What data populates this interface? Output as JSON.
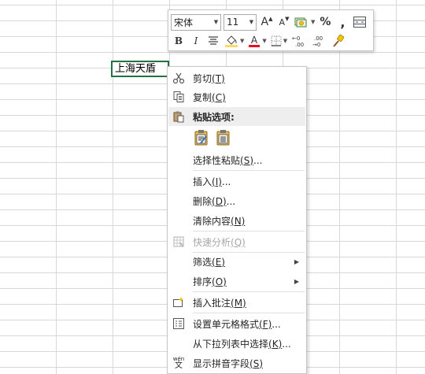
{
  "cell": {
    "value": "上海天盾"
  },
  "mini_toolbar": {
    "font_name": "宋体",
    "font_size": "11",
    "increase_font": "A",
    "decrease_font": "A",
    "percent": "%",
    "comma": ",",
    "bold": "B",
    "italic": "I",
    "font_color_letter": "A",
    "increase_decimal": ".00",
    "decrease_decimal": ".00",
    "font_color": "#e81123",
    "fill_color": "#ffd966"
  },
  "menu": {
    "cut": {
      "label": "剪切",
      "key": "(T)"
    },
    "copy": {
      "label": "复制",
      "key": "(C)"
    },
    "paste_options": {
      "label": "粘贴选项:"
    },
    "paste_special": {
      "label": "选择性粘贴",
      "key": "(S)",
      "suffix": "..."
    },
    "insert": {
      "label": "插入",
      "key": "(I)",
      "suffix": "..."
    },
    "delete": {
      "label": "删除",
      "key": "(D)",
      "suffix": "..."
    },
    "clear": {
      "label": "清除内容",
      "key": "(N)"
    },
    "quick_analysis": {
      "label": "快速分析",
      "key": "(Q)"
    },
    "filter": {
      "label": "筛选",
      "key": "(E)"
    },
    "sort": {
      "label": "排序",
      "key": "(O)"
    },
    "insert_comment": {
      "label": "插入批注",
      "key": "(M)"
    },
    "format_cells": {
      "label": "设置单元格格式",
      "key": "(F)",
      "suffix": "..."
    },
    "pick_list": {
      "label": "从下拉列表中选择",
      "key": "(K)",
      "suffix": "..."
    },
    "phonetic": {
      "label": "显示拼音字段",
      "key": "(S)",
      "icon_text_top": "wén",
      "icon_text_bottom": "文"
    }
  }
}
